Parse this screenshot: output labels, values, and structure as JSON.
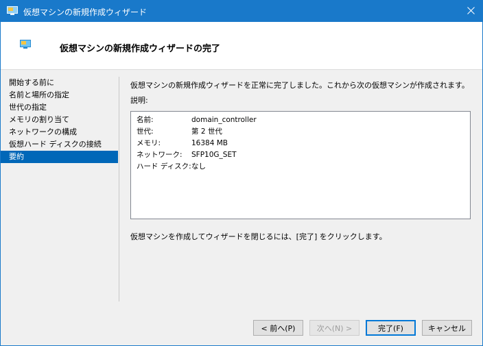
{
  "window": {
    "title": "仮想マシンの新規作成ウィザード"
  },
  "header": {
    "title": "仮想マシンの新規作成ウィザードの完了"
  },
  "nav": {
    "items": [
      {
        "label": "開始する前に"
      },
      {
        "label": "名前と場所の指定"
      },
      {
        "label": "世代の指定"
      },
      {
        "label": "メモリの割り当て"
      },
      {
        "label": "ネットワークの構成"
      },
      {
        "label": "仮想ハード ディスクの接続"
      },
      {
        "label": "要約"
      }
    ],
    "selected": "要約"
  },
  "content": {
    "intro": "仮想マシンの新規作成ウィザードを正常に完了しました。これから次の仮想マシンが作成されます。",
    "description_label": "説明:",
    "summary": [
      {
        "key": "名前:",
        "value": "domain_controller"
      },
      {
        "key": "世代:",
        "value": "第 2 世代"
      },
      {
        "key": "メモリ:",
        "value": "16384 MB"
      },
      {
        "key": "ネットワーク:",
        "value": "SFP10G_SET"
      },
      {
        "key": "ハード ディスク:",
        "value": "なし"
      }
    ],
    "finish_note": "仮想マシンを作成してウィザードを閉じるには、[完了] をクリックします。"
  },
  "buttons": {
    "previous": "< 前へ(P)",
    "next": "次へ(N) >",
    "finish": "完了(F)",
    "cancel": "キャンセル"
  },
  "colors": {
    "titlebar": "#1979ca",
    "selection": "#0067b8"
  }
}
